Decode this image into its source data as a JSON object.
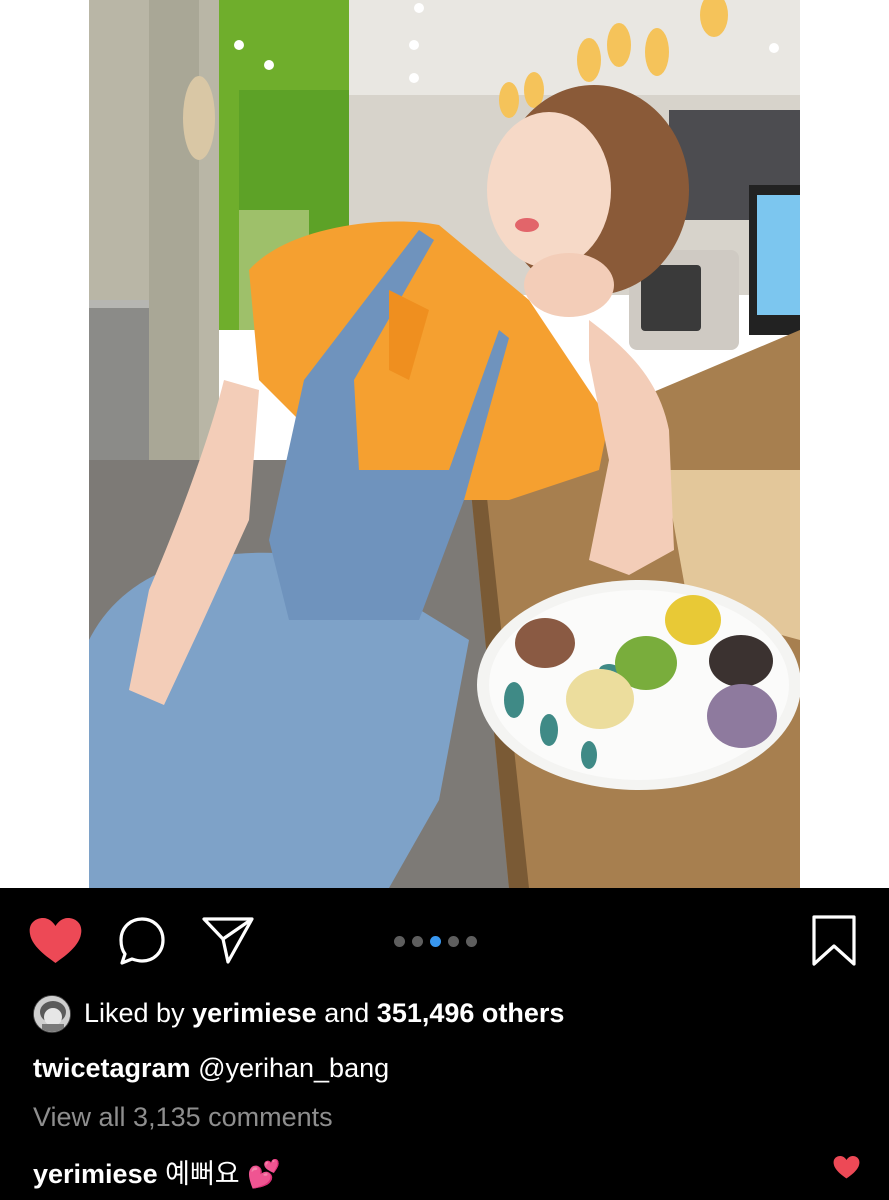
{
  "post": {
    "carousel": {
      "count": 5,
      "active_index": 2
    },
    "likes": {
      "prefix": "Liked by",
      "user": "yerimiese",
      "joiner": "and",
      "others": "351,496 others"
    },
    "caption": {
      "username": "twicetagram",
      "mention": "@yerihan_bang"
    },
    "comments_link": "View all 3,135 comments",
    "comment": {
      "username": "yerimiese",
      "text": "예뻐요",
      "emoji": "💕"
    }
  },
  "icons": {
    "like": "heart-filled-icon",
    "comment": "speech-bubble-icon",
    "share": "paper-plane-icon",
    "save": "bookmark-icon",
    "comment_like": "heart-small-icon"
  },
  "colors": {
    "background": "#000000",
    "heart": "#ed4956",
    "active_dot": "#3897f0",
    "inactive_dot": "#5e5e5e",
    "muted_text": "#8e8e8e"
  }
}
